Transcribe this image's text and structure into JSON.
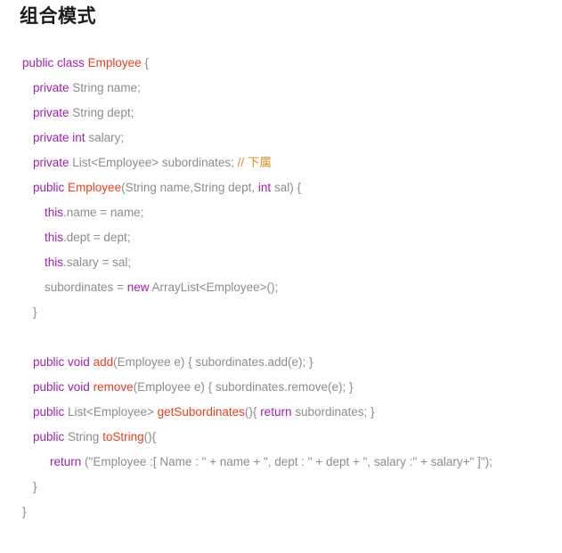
{
  "page": {
    "title": "组合模式",
    "background": "#ffffff"
  },
  "theme": {
    "keyword_color": "#a020b0",
    "type_color": "#e8401f",
    "function_color": "#e8401f",
    "comment_color": "#e09020",
    "text_color": "#8c8c8c",
    "title_color": "#1a1a1a"
  },
  "code": {
    "language": "java",
    "lines": [
      {
        "indent": 0,
        "tokens": [
          {
            "t": "public",
            "c": "kw"
          },
          {
            "t": " ",
            "c": "txt"
          },
          {
            "t": "class",
            "c": "kw"
          },
          {
            "t": " ",
            "c": "txt"
          },
          {
            "t": "Employee",
            "c": "type"
          },
          {
            "t": " {",
            "c": "txt"
          }
        ]
      },
      {
        "indent": 1,
        "tokens": [
          {
            "t": "private",
            "c": "kw"
          },
          {
            "t": " String name;",
            "c": "txt"
          }
        ]
      },
      {
        "indent": 1,
        "tokens": [
          {
            "t": "private",
            "c": "kw"
          },
          {
            "t": " String dept;",
            "c": "txt"
          }
        ]
      },
      {
        "indent": 1,
        "tokens": [
          {
            "t": "private",
            "c": "kw"
          },
          {
            "t": " ",
            "c": "txt"
          },
          {
            "t": "int",
            "c": "kw"
          },
          {
            "t": " salary;",
            "c": "txt"
          }
        ]
      },
      {
        "indent": 1,
        "tokens": [
          {
            "t": "private",
            "c": "kw"
          },
          {
            "t": " List<Employee> subordinates; ",
            "c": "txt"
          },
          {
            "t": "// 下属",
            "c": "cmt"
          }
        ]
      },
      {
        "indent": 1,
        "tokens": [
          {
            "t": "public",
            "c": "kw"
          },
          {
            "t": " ",
            "c": "txt"
          },
          {
            "t": "Employee",
            "c": "type"
          },
          {
            "t": "(String name,String dept, ",
            "c": "txt"
          },
          {
            "t": "int",
            "c": "kw"
          },
          {
            "t": " sal) {",
            "c": "txt"
          }
        ]
      },
      {
        "indent": 2,
        "tokens": [
          {
            "t": "this",
            "c": "kw"
          },
          {
            "t": ".name = name;",
            "c": "txt"
          }
        ]
      },
      {
        "indent": 2,
        "tokens": [
          {
            "t": "this",
            "c": "kw"
          },
          {
            "t": ".dept = dept;",
            "c": "txt"
          }
        ]
      },
      {
        "indent": 2,
        "tokens": [
          {
            "t": "this",
            "c": "kw"
          },
          {
            "t": ".salary = sal;",
            "c": "txt"
          }
        ]
      },
      {
        "indent": 2,
        "tokens": [
          {
            "t": "subordinates = ",
            "c": "txt"
          },
          {
            "t": "new",
            "c": "kw"
          },
          {
            "t": " ArrayList<Employee>();",
            "c": "txt"
          }
        ]
      },
      {
        "indent": 1,
        "tokens": [
          {
            "t": "}",
            "c": "txt"
          }
        ]
      },
      {
        "indent": 0,
        "blank": true,
        "tokens": []
      },
      {
        "indent": 1,
        "tokens": [
          {
            "t": "public",
            "c": "kw"
          },
          {
            "t": " ",
            "c": "txt"
          },
          {
            "t": "void",
            "c": "kw"
          },
          {
            "t": " ",
            "c": "txt"
          },
          {
            "t": "add",
            "c": "fn"
          },
          {
            "t": "(Employee e) { subordinates.add(e); }",
            "c": "txt"
          }
        ]
      },
      {
        "indent": 1,
        "tokens": [
          {
            "t": "public",
            "c": "kw"
          },
          {
            "t": " ",
            "c": "txt"
          },
          {
            "t": "void",
            "c": "kw"
          },
          {
            "t": " ",
            "c": "txt"
          },
          {
            "t": "remove",
            "c": "fn"
          },
          {
            "t": "(Employee e) { subordinates.remove(e); }",
            "c": "txt"
          }
        ]
      },
      {
        "indent": 1,
        "tokens": [
          {
            "t": "public",
            "c": "kw"
          },
          {
            "t": " List<Employee> ",
            "c": "txt"
          },
          {
            "t": "getSubordinates",
            "c": "fn"
          },
          {
            "t": "(){ ",
            "c": "txt"
          },
          {
            "t": "return",
            "c": "kw"
          },
          {
            "t": " subordinates; }",
            "c": "txt"
          }
        ]
      },
      {
        "indent": 1,
        "tokens": [
          {
            "t": "public",
            "c": "kw"
          },
          {
            "t": " String ",
            "c": "txt"
          },
          {
            "t": "toString",
            "c": "fn"
          },
          {
            "t": "(){",
            "c": "txt"
          }
        ]
      },
      {
        "indent": 3,
        "tokens": [
          {
            "t": "return",
            "c": "kw"
          },
          {
            "t": " (\"Employee :[ Name : \" + name + \", dept : \" + dept + \", salary :\" + salary+\" ]\");",
            "c": "txt"
          }
        ]
      },
      {
        "indent": 1,
        "tokens": [
          {
            "t": "}",
            "c": "txt"
          }
        ]
      },
      {
        "indent": 0,
        "tokens": [
          {
            "t": "}",
            "c": "txt"
          }
        ]
      }
    ]
  }
}
